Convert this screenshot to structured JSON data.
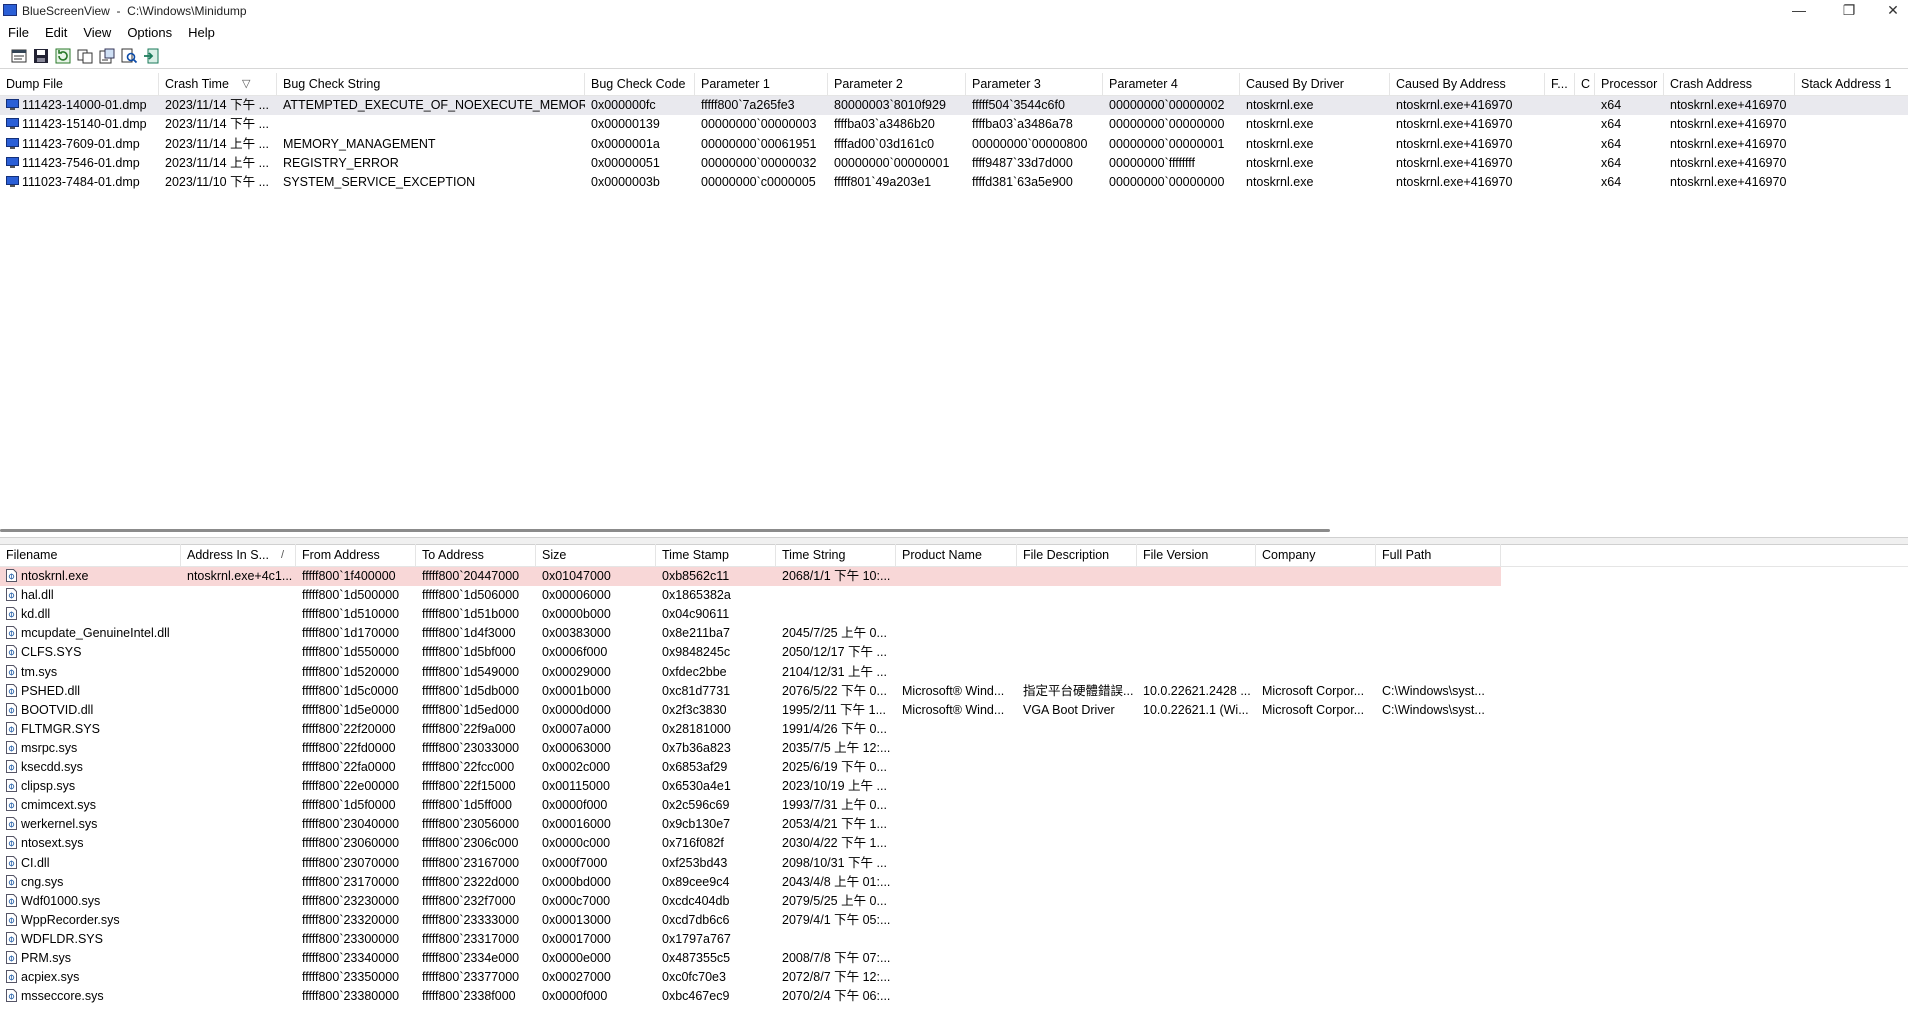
{
  "window": {
    "title": "BlueScreenView  -  C:\\Windows\\Minidump",
    "minimize": "—",
    "maximize": "❐",
    "close": "✕"
  },
  "menu": [
    "File",
    "Edit",
    "View",
    "Options",
    "Help"
  ],
  "toolbar_icons": [
    "properties-icon",
    "save-icon",
    "refresh-icon",
    "copy-icon",
    "report-icon",
    "find-icon",
    "exit-icon"
  ],
  "colors": {
    "selected_row_top": "#e9e9ee",
    "selected_row_bottom": "#f8d7d7",
    "crash_icon": "#2b5fd6"
  },
  "crash_list": {
    "columns": [
      "Dump File",
      "Crash Time",
      "Bug Check String",
      "Bug Check Code",
      "Parameter 1",
      "Parameter 2",
      "Parameter 3",
      "Parameter 4",
      "Caused By Driver",
      "Caused By Address",
      "F...",
      "C",
      "Processor",
      "Crash Address",
      "Stack Address 1"
    ],
    "sort_indicator": "▽",
    "rows": [
      [
        "111423-14000-01.dmp",
        "2023/11/14 下午 ...",
        "ATTEMPTED_EXECUTE_OF_NOEXECUTE_MEMORY",
        "0x000000fc",
        "fffff800`7a265fe3",
        "80000003`8010f929",
        "fffff504`3544c6f0",
        "00000000`00000002",
        "ntoskrnl.exe",
        "ntoskrnl.exe+416970",
        "",
        "",
        "x64",
        "ntoskrnl.exe+416970",
        ""
      ],
      [
        "111423-15140-01.dmp",
        "2023/11/14 下午 ...",
        "",
        "0x00000139",
        "00000000`00000003",
        "ffffba03`a3486b20",
        "ffffba03`a3486a78",
        "00000000`00000000",
        "ntoskrnl.exe",
        "ntoskrnl.exe+416970",
        "",
        "",
        "x64",
        "ntoskrnl.exe+416970",
        ""
      ],
      [
        "111423-7609-01.dmp",
        "2023/11/14 上午 ...",
        "MEMORY_MANAGEMENT",
        "0x0000001a",
        "00000000`00061951",
        "ffffad00`03d161c0",
        "00000000`00000800",
        "00000000`00000001",
        "ntoskrnl.exe",
        "ntoskrnl.exe+416970",
        "",
        "",
        "x64",
        "ntoskrnl.exe+416970",
        ""
      ],
      [
        "111423-7546-01.dmp",
        "2023/11/14 上午 ...",
        "REGISTRY_ERROR",
        "0x00000051",
        "00000000`00000032",
        "00000000`00000001",
        "ffff9487`33d7d000",
        "00000000`ffffffff",
        "ntoskrnl.exe",
        "ntoskrnl.exe+416970",
        "",
        "",
        "x64",
        "ntoskrnl.exe+416970",
        ""
      ],
      [
        "111023-7484-01.dmp",
        "2023/11/10 下午 ...",
        "SYSTEM_SERVICE_EXCEPTION",
        "0x0000003b",
        "00000000`c0000005",
        "fffff801`49a203e1",
        "ffffd381`63a5e900",
        "00000000`00000000",
        "ntoskrnl.exe",
        "ntoskrnl.exe+416970",
        "",
        "",
        "x64",
        "ntoskrnl.exe+416970",
        ""
      ]
    ]
  },
  "driver_list": {
    "columns": [
      "Filename",
      "Address In S...",
      "From Address",
      "To Address",
      "Size",
      "Time Stamp",
      "Time String",
      "Product Name",
      "File Description",
      "File Version",
      "Company",
      "Full Path"
    ],
    "sort_indicator": "/",
    "rows": [
      [
        "ntoskrnl.exe",
        "ntoskrnl.exe+4c1...",
        "fffff800`1f400000",
        "fffff800`20447000",
        "0x01047000",
        "0xb8562c11",
        "2068/1/1 下午 10:...",
        "",
        "",
        "",
        "",
        ""
      ],
      [
        "hal.dll",
        "",
        "fffff800`1d500000",
        "fffff800`1d506000",
        "0x00006000",
        "0x1865382a",
        "",
        "",
        "",
        "",
        "",
        ""
      ],
      [
        "kd.dll",
        "",
        "fffff800`1d510000",
        "fffff800`1d51b000",
        "0x0000b000",
        "0x04c90611",
        "",
        "",
        "",
        "",
        "",
        ""
      ],
      [
        "mcupdate_GenuineIntel.dll",
        "",
        "fffff800`1d170000",
        "fffff800`1d4f3000",
        "0x00383000",
        "0x8e211ba7",
        "2045/7/25 上午 0...",
        "",
        "",
        "",
        "",
        ""
      ],
      [
        "CLFS.SYS",
        "",
        "fffff800`1d550000",
        "fffff800`1d5bf000",
        "0x0006f000",
        "0x9848245c",
        "2050/12/17 下午 ...",
        "",
        "",
        "",
        "",
        ""
      ],
      [
        "tm.sys",
        "",
        "fffff800`1d520000",
        "fffff800`1d549000",
        "0x00029000",
        "0xfdec2bbe",
        "2104/12/31 上午 ...",
        "",
        "",
        "",
        "",
        ""
      ],
      [
        "PSHED.dll",
        "",
        "fffff800`1d5c0000",
        "fffff800`1d5db000",
        "0x0001b000",
        "0xc81d7731",
        "2076/5/22 下午 0...",
        "Microsoft® Wind...",
        "指定平台硬體錯誤...",
        "10.0.22621.2428 ...",
        "Microsoft Corpor...",
        "C:\\Windows\\syst..."
      ],
      [
        "BOOTVID.dll",
        "",
        "fffff800`1d5e0000",
        "fffff800`1d5ed000",
        "0x0000d000",
        "0x2f3c3830",
        "1995/2/11 下午 1...",
        "Microsoft® Wind...",
        "VGA Boot Driver",
        "10.0.22621.1 (Wi...",
        "Microsoft Corpor...",
        "C:\\Windows\\syst..."
      ],
      [
        "FLTMGR.SYS",
        "",
        "fffff800`22f20000",
        "fffff800`22f9a000",
        "0x0007a000",
        "0x28181000",
        "1991/4/26 下午 0...",
        "",
        "",
        "",
        "",
        ""
      ],
      [
        "msrpc.sys",
        "",
        "fffff800`22fd0000",
        "fffff800`23033000",
        "0x00063000",
        "0x7b36a823",
        "2035/7/5 上午 12:...",
        "",
        "",
        "",
        "",
        ""
      ],
      [
        "ksecdd.sys",
        "",
        "fffff800`22fa0000",
        "fffff800`22fcc000",
        "0x0002c000",
        "0x6853af29",
        "2025/6/19 下午 0...",
        "",
        "",
        "",
        "",
        ""
      ],
      [
        "clipsp.sys",
        "",
        "fffff800`22e00000",
        "fffff800`22f15000",
        "0x00115000",
        "0x6530a4e1",
        "2023/10/19 上午 ...",
        "",
        "",
        "",
        "",
        ""
      ],
      [
        "cmimcext.sys",
        "",
        "fffff800`1d5f0000",
        "fffff800`1d5ff000",
        "0x0000f000",
        "0x2c596c69",
        "1993/7/31 上午 0...",
        "",
        "",
        "",
        "",
        ""
      ],
      [
        "werkernel.sys",
        "",
        "fffff800`23040000",
        "fffff800`23056000",
        "0x00016000",
        "0x9cb130e7",
        "2053/4/21 下午 1...",
        "",
        "",
        "",
        "",
        ""
      ],
      [
        "ntosext.sys",
        "",
        "fffff800`23060000",
        "fffff800`2306c000",
        "0x0000c000",
        "0x716f082f",
        "2030/4/22 下午 1...",
        "",
        "",
        "",
        "",
        ""
      ],
      [
        "CI.dll",
        "",
        "fffff800`23070000",
        "fffff800`23167000",
        "0x000f7000",
        "0xf253bd43",
        "2098/10/31 下午 ...",
        "",
        "",
        "",
        "",
        ""
      ],
      [
        "cng.sys",
        "",
        "fffff800`23170000",
        "fffff800`2322d000",
        "0x000bd000",
        "0x89cee9c4",
        "2043/4/8 上午 01:...",
        "",
        "",
        "",
        "",
        ""
      ],
      [
        "Wdf01000.sys",
        "",
        "fffff800`23230000",
        "fffff800`232f7000",
        "0x000c7000",
        "0xcdc404db",
        "2079/5/25 上午 0...",
        "",
        "",
        "",
        "",
        ""
      ],
      [
        "WppRecorder.sys",
        "",
        "fffff800`23320000",
        "fffff800`23333000",
        "0x00013000",
        "0xcd7db6c6",
        "2079/4/1 下午 05:...",
        "",
        "",
        "",
        "",
        ""
      ],
      [
        "WDFLDR.SYS",
        "",
        "fffff800`23300000",
        "fffff800`23317000",
        "0x00017000",
        "0x1797a767",
        "",
        "",
        "",
        "",
        "",
        ""
      ],
      [
        "PRM.sys",
        "",
        "fffff800`23340000",
        "fffff800`2334e000",
        "0x0000e000",
        "0x487355c5",
        "2008/7/8 下午 07:...",
        "",
        "",
        "",
        "",
        ""
      ],
      [
        "acpiex.sys",
        "",
        "fffff800`23350000",
        "fffff800`23377000",
        "0x00027000",
        "0xc0fc70e3",
        "2072/8/7 下午 12:...",
        "",
        "",
        "",
        "",
        ""
      ],
      [
        "msseccore.sys",
        "",
        "fffff800`23380000",
        "fffff800`2338f000",
        "0x0000f000",
        "0xbc467ec9",
        "2070/2/4 下午 06:...",
        "",
        "",
        "",
        "",
        ""
      ]
    ]
  }
}
